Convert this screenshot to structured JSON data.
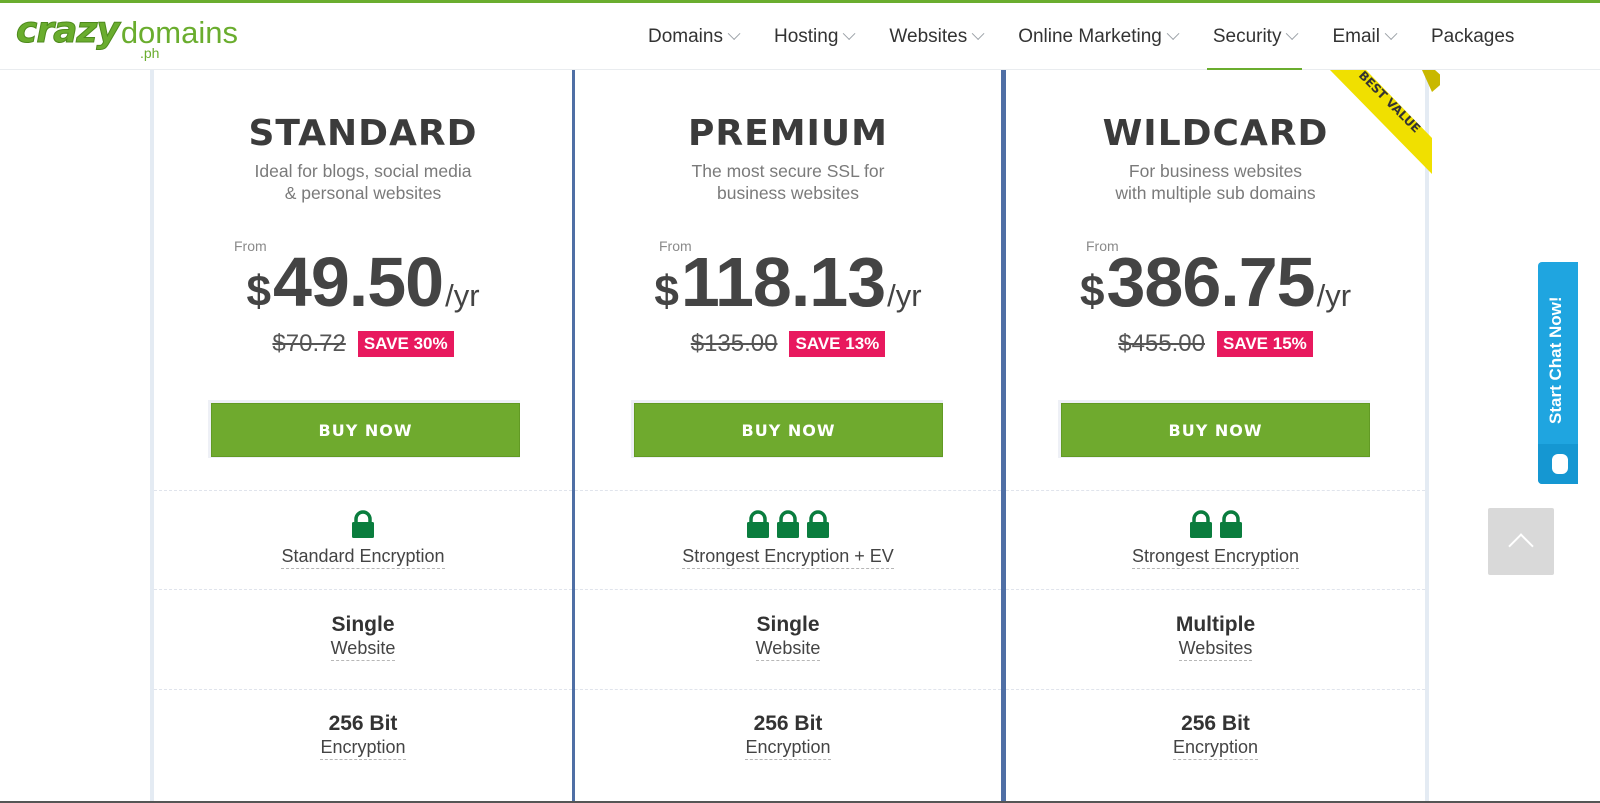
{
  "brand": {
    "logo_primary": "crazy",
    "logo_secondary": "domains",
    "logo_tld": ".ph",
    "accent_color": "#6aad2e"
  },
  "nav": {
    "items": [
      {
        "label": "Domains",
        "has_dropdown": true,
        "active": false
      },
      {
        "label": "Hosting",
        "has_dropdown": true,
        "active": false
      },
      {
        "label": "Websites",
        "has_dropdown": true,
        "active": false
      },
      {
        "label": "Online Marketing",
        "has_dropdown": true,
        "active": false
      },
      {
        "label": "Security",
        "has_dropdown": true,
        "active": true
      },
      {
        "label": "Email",
        "has_dropdown": true,
        "active": false
      },
      {
        "label": "Packages",
        "has_dropdown": false,
        "active": false
      }
    ]
  },
  "plans": [
    {
      "name": "STANDARD",
      "desc_line1": "Ideal for blogs, social media",
      "desc_line2": "& personal websites",
      "from_label": "From",
      "currency": "$",
      "price": "49.50",
      "period": "/yr",
      "old_price": "$70.72",
      "save_label": "SAVE 30%",
      "buy_label": "BUY NOW",
      "lock_count": 1,
      "encryption_label": "Standard Encryption",
      "sites_main": "Single",
      "sites_sub": "Website",
      "bits_main": "256 Bit",
      "bits_sub": "Encryption"
    },
    {
      "name": "PREMIUM",
      "desc_line1": "The most secure SSL for",
      "desc_line2": "business websites",
      "from_label": "From",
      "currency": "$",
      "price": "118.13",
      "period": "/yr",
      "old_price": "$135.00",
      "save_label": "SAVE 13%",
      "buy_label": "BUY NOW",
      "lock_count": 3,
      "encryption_label": "Strongest Encryption + EV",
      "sites_main": "Single",
      "sites_sub": "Website",
      "bits_main": "256 Bit",
      "bits_sub": "Encryption"
    },
    {
      "name": "WILDCARD",
      "desc_line1": "For business websites",
      "desc_line2": "with multiple sub domains",
      "from_label": "From",
      "currency": "$",
      "price": "386.75",
      "period": "/yr",
      "old_price": "$455.00",
      "save_label": "SAVE 15%",
      "buy_label": "BUY NOW",
      "lock_count": 2,
      "encryption_label": "Strongest Encryption",
      "sites_main": "Multiple",
      "sites_sub": "Websites",
      "bits_main": "256 Bit",
      "bits_sub": "Encryption",
      "ribbon_label": "BEST VALUE"
    }
  ],
  "colors": {
    "buy_button": "#6faa2e",
    "save_badge": "#e8195e",
    "lock": "#0a7d3e",
    "ribbon": "#f0e000",
    "chat": "#1fa5e0"
  },
  "chat": {
    "label": "Start Chat Now!"
  },
  "scroll_top": {
    "icon": "chevron-up-icon"
  }
}
